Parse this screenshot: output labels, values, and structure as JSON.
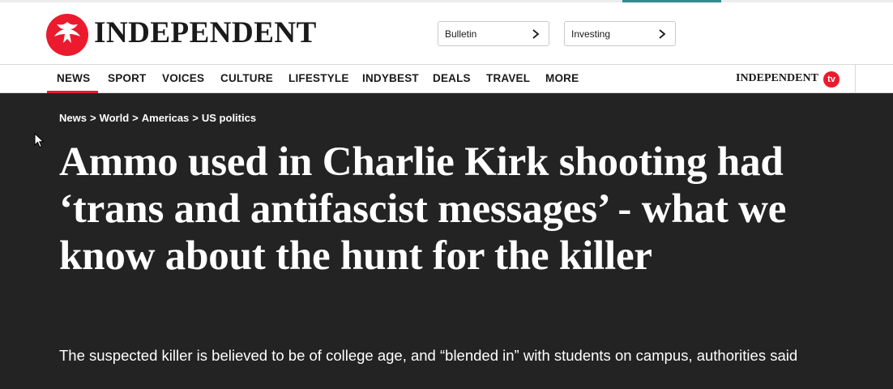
{
  "site": {
    "name": "INDEPENDENT"
  },
  "header": {
    "pills": [
      {
        "label": "Bulletin"
      },
      {
        "label": "Investing"
      }
    ]
  },
  "nav": {
    "items": [
      "NEWS",
      "SPORT",
      "VOICES",
      "CULTURE",
      "LIFESTYLE",
      "INDYBEST",
      "DEALS",
      "TRAVEL",
      "MORE"
    ],
    "active": "NEWS",
    "tv_logo": "INDEPENDENT",
    "tv_badge": "tv"
  },
  "breadcrumb": [
    {
      "label": "News"
    },
    {
      "label": "World"
    },
    {
      "label": "Americas"
    },
    {
      "label": "US politics"
    }
  ],
  "breadcrumb_separator": ">",
  "article": {
    "headline": "Ammo used in Charlie Kirk shooting had ‘trans and antifascist messages’ - what we know about the hunt for the killer",
    "standfirst": "The suspected killer is believed to be of college age, and “blended in” with students on campus, authorities said"
  },
  "colors": {
    "brand_red": "#ec1a2e",
    "hero_bg": "#232323",
    "accent_teal": "#2f8c8c"
  },
  "icons": {
    "logo": "eagle-logo-icon",
    "pill_chevron": "chevron-right-icon",
    "cursor": "mouse-pointer-icon"
  }
}
